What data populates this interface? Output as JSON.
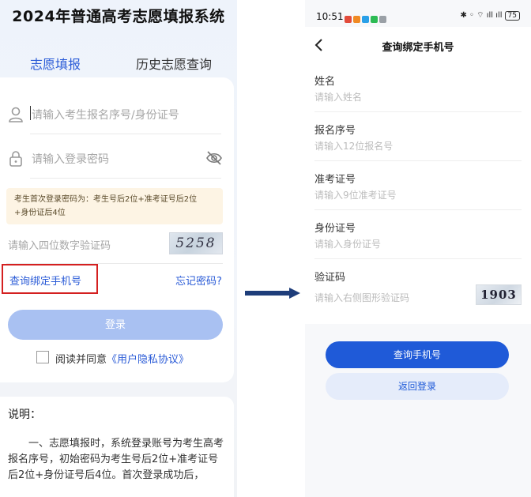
{
  "left": {
    "title": "2024年普通高考志愿填报系统",
    "tabs": [
      {
        "label": "志愿填报",
        "active": true
      },
      {
        "label": "历史志愿查询",
        "active": false
      }
    ],
    "username_placeholder": "请输入考生报名序号/身份证号",
    "password_placeholder": "请输入登录密码",
    "notice_line1": "考生首次登录密码为：考生号后2位+准考证号后2位",
    "notice_line2": "+身份证后4位",
    "captcha_placeholder": "请输入四位数字验证码",
    "captcha_text": "5258",
    "query_phone_link": "查询绑定手机号",
    "forgot_link": "忘记密码?",
    "login_button": "登录",
    "agree_prefix": "阅读并同意",
    "agree_link": "《用户隐私协议》",
    "explain_title": "说明：",
    "explain_body": "一、志愿填报时，系统登录账号为考生高考报名序号，初始密码为考生号后2位+准考证号后2位+身份证号后4位。首次登录成功后，",
    "colors": {
      "primary": "#2a5bd7",
      "highlight_border": "#d42020",
      "login_disabled": "#a9c1f2",
      "notice_bg": "#fdf4e4"
    }
  },
  "right": {
    "status_time": "10:51",
    "battery": "75",
    "nav_title": "查询绑定手机号",
    "fields": [
      {
        "label": "姓名",
        "placeholder": "请输入姓名"
      },
      {
        "label": "报名序号",
        "placeholder": "请输入12位报名号"
      },
      {
        "label": "准考证号",
        "placeholder": "请输入9位准考证号"
      },
      {
        "label": "身份证号",
        "placeholder": "请输入身份证号"
      },
      {
        "label": "验证码",
        "placeholder": "请输入右侧图形验证码"
      }
    ],
    "captcha_text": "1903",
    "primary_button": "查询手机号",
    "secondary_button": "返回登录",
    "colors": {
      "primary": "#1f5ad8",
      "secondary_bg": "#e5ecfa"
    }
  }
}
